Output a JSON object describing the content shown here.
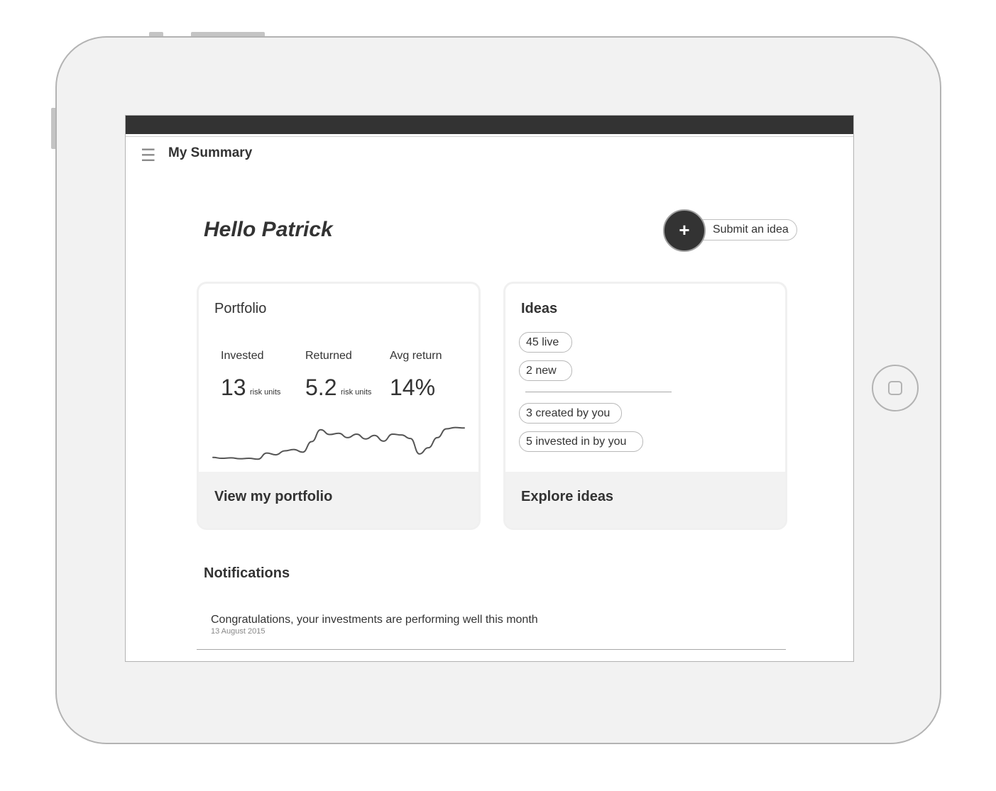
{
  "app": {
    "menu_icon": "hamburger-icon",
    "menu_glyph": "☰",
    "page_title": "My Summary"
  },
  "greeting": "Hello Patrick",
  "submit": {
    "plus_icon": "plus-icon",
    "plus_glyph": "+",
    "label": "Submit an idea"
  },
  "portfolio": {
    "title": "Portfolio",
    "stats": [
      {
        "label": "Invested",
        "value": "13",
        "unit": "risk units"
      },
      {
        "label": "Returned",
        "value": "5.2",
        "unit": "risk units"
      },
      {
        "label": "Avg return",
        "value": "14%",
        "unit": ""
      }
    ],
    "sparkline_values": [
      0.1,
      0.08,
      0.09,
      0.07,
      0.08,
      0.06,
      0.2,
      0.16,
      0.25,
      0.28,
      0.22,
      0.46,
      0.73,
      0.62,
      0.65,
      0.55,
      0.63,
      0.52,
      0.6,
      0.47,
      0.63,
      0.61,
      0.53,
      0.18,
      0.32,
      0.55,
      0.75,
      0.78,
      0.77
    ],
    "footer_label": "View my portfolio"
  },
  "ideas": {
    "title": "Ideas",
    "pills_top": [
      "45 live",
      "2 new"
    ],
    "pills_bottom": [
      "3 created by you",
      "5 invested in by you"
    ],
    "footer_label": "Explore ideas"
  },
  "notifications": {
    "heading": "Notifications",
    "items": [
      {
        "text": "Congratulations, your investments are performing well this month",
        "date": "13 August 2015"
      }
    ]
  },
  "colors": {
    "device_frame": "#f2f2f2",
    "status_bar": "#333333",
    "accent_dark": "#333333",
    "card_footer": "#f2f2f2"
  }
}
